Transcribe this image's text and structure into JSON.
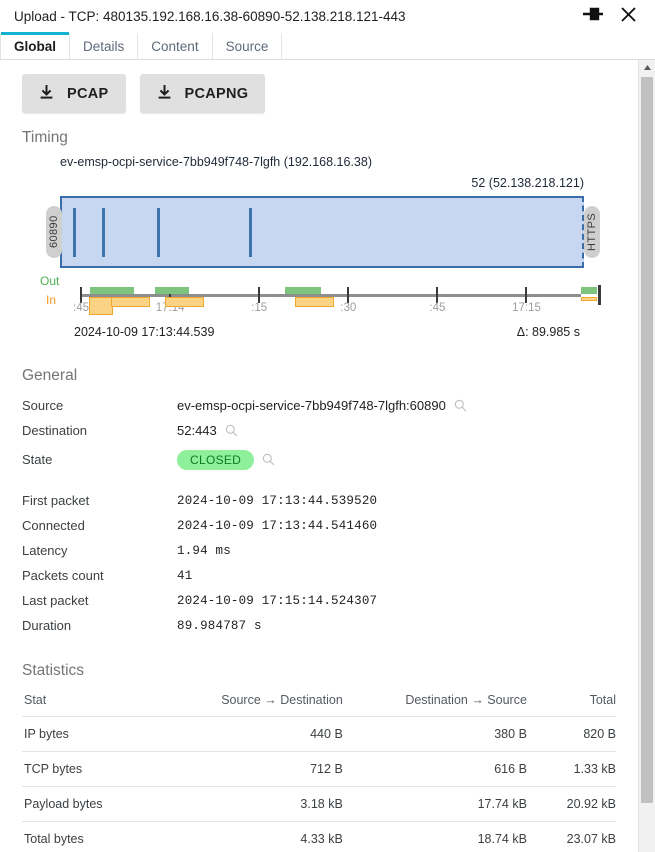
{
  "window": {
    "title": "Upload - TCP: 480135.192.168.16.38-60890-52.138.218.121-443",
    "pin_icon": "pin-icon",
    "close_icon": "close-icon"
  },
  "tabs": [
    {
      "label": "Global",
      "active": true
    },
    {
      "label": "Details",
      "active": false
    },
    {
      "label": "Content",
      "active": false
    },
    {
      "label": "Source",
      "active": false
    }
  ],
  "toolbar": {
    "pcap_label": "PCAP",
    "pcapng_label": "PCAPNG",
    "download_icon": "download-icon"
  },
  "timing": {
    "section_title": "Timing",
    "source_endpoint": "ev-emsp-ocpi-service-7bb949f748-7lgfh (192.168.16.38)",
    "destination_endpoint": "52 (52.138.218.121)",
    "source_port_tag": "60890",
    "destination_port_tag": "HTTPS",
    "out_label": "Out",
    "in_label": "In",
    "start_time": "2024-10-09 17:13:44.539",
    "delta": "Δ: 89.985 s",
    "axis_ticks": [
      ":45",
      "17:14",
      ":15",
      ":30",
      ":45",
      "17:15"
    ],
    "packet_marks_pct": [
      2.5,
      8.0,
      18.5,
      36.0
    ],
    "out_bars_pct": [
      {
        "x": 2.0,
        "w": 2.0
      },
      {
        "x": 4.0,
        "w": 6.5
      },
      {
        "x": 14.5,
        "w": 6.5
      },
      {
        "x": 39.5,
        "w": 7.0
      },
      {
        "x": 96.8,
        "w": 3.0
      }
    ],
    "in_bars_pct": [
      {
        "x": 1.8,
        "w": 4.5
      },
      {
        "x": 6.0,
        "w": 7.5
      },
      {
        "x": 16.5,
        "w": 7.5
      },
      {
        "x": 41.5,
        "w": 7.5
      },
      {
        "x": 96.8,
        "w": 3.0
      }
    ]
  },
  "general": {
    "section_title": "General",
    "rows": [
      {
        "key": "Source",
        "value": "ev-emsp-ocpi-service-7bb949f748-7lgfh:60890",
        "mono": false,
        "search": true,
        "badge": false
      },
      {
        "key": "Destination",
        "value": "52:443",
        "mono": false,
        "search": true,
        "badge": false
      },
      {
        "key": "State",
        "value": "CLOSED",
        "mono": false,
        "search": true,
        "badge": true
      }
    ],
    "detail_rows": [
      {
        "key": "First packet",
        "value": "2024-10-09 17:13:44.539520"
      },
      {
        "key": "Connected",
        "value": "2024-10-09 17:13:44.541460"
      },
      {
        "key": "Latency",
        "value": "1.94 ms"
      },
      {
        "key": "Packets count",
        "value": "41"
      },
      {
        "key": "Last packet",
        "value": "2024-10-09 17:15:14.524307"
      },
      {
        "key": "Duration",
        "value": "89.984787 s"
      }
    ]
  },
  "statistics": {
    "section_title": "Statistics",
    "columns": [
      "Stat",
      "Source → Destination",
      "Destination → Source",
      "Total"
    ],
    "rows": [
      {
        "stat": "IP bytes",
        "src_dst": "440 B",
        "dst_src": "380 B",
        "total": "820 B"
      },
      {
        "stat": "TCP bytes",
        "src_dst": "712 B",
        "dst_src": "616 B",
        "total": "1.33 kB"
      },
      {
        "stat": "Payload bytes",
        "src_dst": "3.18 kB",
        "dst_src": "17.74 kB",
        "total": "20.92 kB"
      },
      {
        "stat": "Total bytes",
        "src_dst": "4.33 kB",
        "dst_src": "18.74 kB",
        "total": "23.07 kB"
      }
    ]
  },
  "colors": {
    "accent": "#14b3d1",
    "flow_fill": "#c7d7f2",
    "flow_border": "#3b6ea5",
    "out": "#7dc47f",
    "in": "#fbd385",
    "badge_bg": "#8ef09a",
    "badge_text": "#0f7a25"
  }
}
